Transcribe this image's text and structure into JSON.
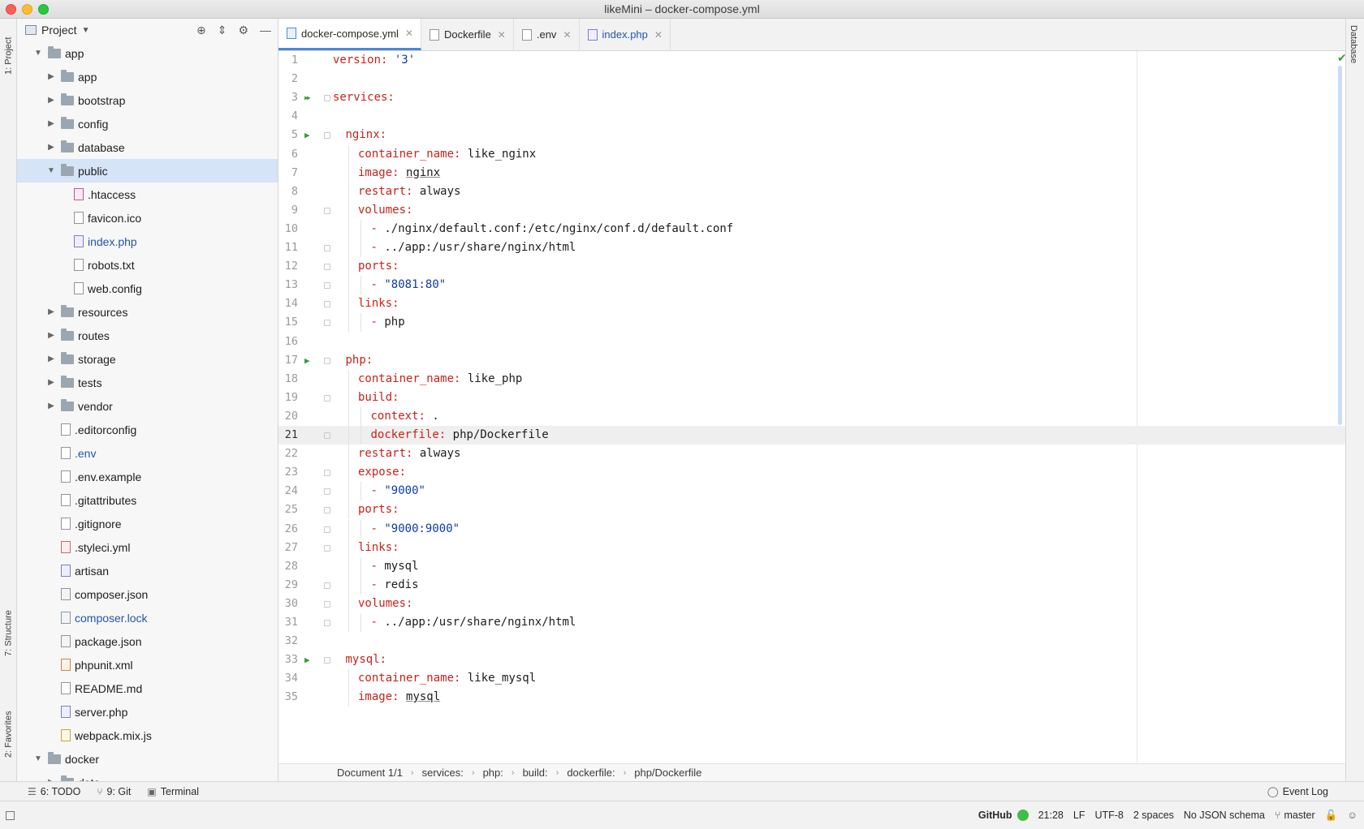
{
  "window": {
    "title": "likeMini – docker-compose.yml"
  },
  "left_strip": {
    "project_tab": "1: Project",
    "structure_tab": "7: Structure",
    "favorites_tab": "2: Favorites"
  },
  "right_strip": {
    "database_tab": "Database"
  },
  "project_panel": {
    "title": "Project",
    "tree": [
      {
        "label": "app",
        "type": "folder",
        "depth": 0,
        "expanded": true
      },
      {
        "label": "app",
        "type": "folder",
        "depth": 1,
        "expanded": false
      },
      {
        "label": "bootstrap",
        "type": "folder",
        "depth": 1,
        "expanded": false
      },
      {
        "label": "config",
        "type": "folder",
        "depth": 1,
        "expanded": false
      },
      {
        "label": "database",
        "type": "folder",
        "depth": 1,
        "expanded": false
      },
      {
        "label": "public",
        "type": "folder",
        "depth": 1,
        "expanded": true,
        "selected": true
      },
      {
        "label": ".htaccess",
        "type": "file",
        "icon": "ht",
        "depth": 2
      },
      {
        "label": "favicon.ico",
        "type": "file",
        "icon": "plain",
        "depth": 2
      },
      {
        "label": "index.php",
        "type": "file",
        "icon": "php",
        "depth": 2,
        "highlight": true
      },
      {
        "label": "robots.txt",
        "type": "file",
        "icon": "plain",
        "depth": 2
      },
      {
        "label": "web.config",
        "type": "file",
        "icon": "plain",
        "depth": 2
      },
      {
        "label": "resources",
        "type": "folder",
        "depth": 1,
        "expanded": false
      },
      {
        "label": "routes",
        "type": "folder",
        "depth": 1,
        "expanded": false
      },
      {
        "label": "storage",
        "type": "folder",
        "depth": 1,
        "expanded": false
      },
      {
        "label": "tests",
        "type": "folder",
        "depth": 1,
        "expanded": false
      },
      {
        "label": "vendor",
        "type": "folder",
        "depth": 1,
        "expanded": false
      },
      {
        "label": ".editorconfig",
        "type": "file",
        "icon": "gear",
        "depth": 1
      },
      {
        "label": ".env",
        "type": "file",
        "icon": "plain",
        "depth": 1,
        "highlight": true
      },
      {
        "label": ".env.example",
        "type": "file",
        "icon": "plain",
        "depth": 1
      },
      {
        "label": ".gitattributes",
        "type": "file",
        "icon": "plain",
        "depth": 1
      },
      {
        "label": ".gitignore",
        "type": "file",
        "icon": "plain",
        "depth": 1
      },
      {
        "label": ".styleci.yml",
        "type": "file",
        "icon": "yml",
        "depth": 1
      },
      {
        "label": "artisan",
        "type": "file",
        "icon": "php",
        "depth": 1
      },
      {
        "label": "composer.json",
        "type": "file",
        "icon": "json",
        "depth": 1
      },
      {
        "label": "composer.lock",
        "type": "file",
        "icon": "json",
        "depth": 1,
        "highlight": true
      },
      {
        "label": "package.json",
        "type": "file",
        "icon": "json",
        "depth": 1
      },
      {
        "label": "phpunit.xml",
        "type": "file",
        "icon": "xml",
        "depth": 1
      },
      {
        "label": "README.md",
        "type": "file",
        "icon": "plain",
        "depth": 1
      },
      {
        "label": "server.php",
        "type": "file",
        "icon": "php",
        "depth": 1
      },
      {
        "label": "webpack.mix.js",
        "type": "file",
        "icon": "js",
        "depth": 1
      },
      {
        "label": "docker",
        "type": "folder",
        "depth": 0,
        "expanded": true
      },
      {
        "label": "data",
        "type": "folder",
        "depth": 1,
        "expanded": false
      }
    ]
  },
  "tabs": [
    {
      "label": "docker-compose.yml",
      "icon": "dc",
      "active": true
    },
    {
      "label": "Dockerfile",
      "icon": "plain",
      "active": false
    },
    {
      "label": ".env",
      "icon": "plain",
      "active": false
    },
    {
      "label": "index.php",
      "icon": "php",
      "active": false,
      "highlight": true
    }
  ],
  "editor": {
    "current_line": 21,
    "lines": [
      {
        "n": 1,
        "indent": 0,
        "parts": [
          [
            "k",
            "version:"
          ],
          [
            "v",
            " "
          ],
          [
            "s",
            "'3'"
          ]
        ]
      },
      {
        "n": 2,
        "indent": 0,
        "parts": []
      },
      {
        "n": 3,
        "indent": 0,
        "run": "double",
        "fold": true,
        "parts": [
          [
            "k",
            "services:"
          ]
        ]
      },
      {
        "n": 4,
        "indent": 0,
        "parts": []
      },
      {
        "n": 5,
        "indent": 1,
        "run": "single",
        "fold": true,
        "parts": [
          [
            "k",
            "nginx:"
          ]
        ]
      },
      {
        "n": 6,
        "indent": 2,
        "parts": [
          [
            "k",
            "container_name:"
          ],
          [
            "v",
            " like_nginx"
          ]
        ]
      },
      {
        "n": 7,
        "indent": 2,
        "parts": [
          [
            "k",
            "image:"
          ],
          [
            "v",
            " "
          ],
          [
            "u",
            "nginx"
          ]
        ]
      },
      {
        "n": 8,
        "indent": 2,
        "parts": [
          [
            "k",
            "restart:"
          ],
          [
            "v",
            " always"
          ]
        ]
      },
      {
        "n": 9,
        "indent": 2,
        "fold": true,
        "parts": [
          [
            "k",
            "volumes:"
          ]
        ]
      },
      {
        "n": 10,
        "indent": 3,
        "parts": [
          [
            "k",
            "- "
          ],
          [
            "v",
            "./nginx/default.conf:/etc/nginx/conf.d/default.conf"
          ]
        ]
      },
      {
        "n": 11,
        "indent": 3,
        "fold": true,
        "parts": [
          [
            "k",
            "- "
          ],
          [
            "v",
            "../app:/usr/share/nginx/html"
          ]
        ]
      },
      {
        "n": 12,
        "indent": 2,
        "fold": true,
        "parts": [
          [
            "k",
            "ports:"
          ]
        ]
      },
      {
        "n": 13,
        "indent": 3,
        "fold": true,
        "parts": [
          [
            "k",
            "- "
          ],
          [
            "s",
            "\"8081:80\""
          ]
        ]
      },
      {
        "n": 14,
        "indent": 2,
        "fold": true,
        "parts": [
          [
            "k",
            "links:"
          ]
        ]
      },
      {
        "n": 15,
        "indent": 3,
        "fold": true,
        "parts": [
          [
            "k",
            "- "
          ],
          [
            "v",
            "php"
          ]
        ]
      },
      {
        "n": 16,
        "indent": 0,
        "parts": []
      },
      {
        "n": 17,
        "indent": 1,
        "run": "single",
        "fold": true,
        "parts": [
          [
            "k",
            "php:"
          ]
        ]
      },
      {
        "n": 18,
        "indent": 2,
        "parts": [
          [
            "k",
            "container_name:"
          ],
          [
            "v",
            " like_php"
          ]
        ]
      },
      {
        "n": 19,
        "indent": 2,
        "fold": true,
        "parts": [
          [
            "k",
            "build:"
          ]
        ]
      },
      {
        "n": 20,
        "indent": 3,
        "parts": [
          [
            "k",
            "context:"
          ],
          [
            "v",
            " ."
          ]
        ]
      },
      {
        "n": 21,
        "indent": 3,
        "fold": true,
        "parts": [
          [
            "k",
            "dockerfile:"
          ],
          [
            "v",
            " php/Dockerfile"
          ]
        ]
      },
      {
        "n": 22,
        "indent": 2,
        "parts": [
          [
            "k",
            "restart:"
          ],
          [
            "v",
            " always"
          ]
        ]
      },
      {
        "n": 23,
        "indent": 2,
        "fold": true,
        "parts": [
          [
            "k",
            "expose:"
          ]
        ]
      },
      {
        "n": 24,
        "indent": 3,
        "fold": true,
        "parts": [
          [
            "k",
            "- "
          ],
          [
            "s",
            "\"9000\""
          ]
        ]
      },
      {
        "n": 25,
        "indent": 2,
        "fold": true,
        "parts": [
          [
            "k",
            "ports:"
          ]
        ]
      },
      {
        "n": 26,
        "indent": 3,
        "fold": true,
        "parts": [
          [
            "k",
            "- "
          ],
          [
            "s",
            "\"9000:9000\""
          ]
        ]
      },
      {
        "n": 27,
        "indent": 2,
        "fold": true,
        "parts": [
          [
            "k",
            "links:"
          ]
        ]
      },
      {
        "n": 28,
        "indent": 3,
        "parts": [
          [
            "k",
            "- "
          ],
          [
            "v",
            "mysql"
          ]
        ]
      },
      {
        "n": 29,
        "indent": 3,
        "fold": true,
        "parts": [
          [
            "k",
            "- "
          ],
          [
            "v",
            "redis"
          ]
        ]
      },
      {
        "n": 30,
        "indent": 2,
        "fold": true,
        "parts": [
          [
            "k",
            "volumes:"
          ]
        ]
      },
      {
        "n": 31,
        "indent": 3,
        "fold": true,
        "parts": [
          [
            "k",
            "- "
          ],
          [
            "v",
            "../app:/usr/share/nginx/html"
          ]
        ]
      },
      {
        "n": 32,
        "indent": 0,
        "parts": []
      },
      {
        "n": 33,
        "indent": 1,
        "run": "single",
        "fold": true,
        "parts": [
          [
            "k",
            "mysql:"
          ]
        ]
      },
      {
        "n": 34,
        "indent": 2,
        "parts": [
          [
            "k",
            "container_name:"
          ],
          [
            "v",
            " like_mysql"
          ]
        ]
      },
      {
        "n": 35,
        "indent": 2,
        "parts": [
          [
            "k",
            "image:"
          ],
          [
            "v",
            " "
          ],
          [
            "u",
            "mysql"
          ]
        ]
      }
    ]
  },
  "breadcrumb": [
    "Document 1/1",
    "services:",
    "php:",
    "build:",
    "dockerfile:",
    "php/Dockerfile"
  ],
  "toolwindows": {
    "todo": "6: TODO",
    "git": "9: Git",
    "terminal": "Terminal",
    "event_log": "Event Log"
  },
  "status": {
    "github": "GitHub",
    "position": "21:28",
    "line_sep": "LF",
    "encoding": "UTF-8",
    "indent": "2 spaces",
    "schema": "No JSON schema",
    "branch": "master"
  }
}
